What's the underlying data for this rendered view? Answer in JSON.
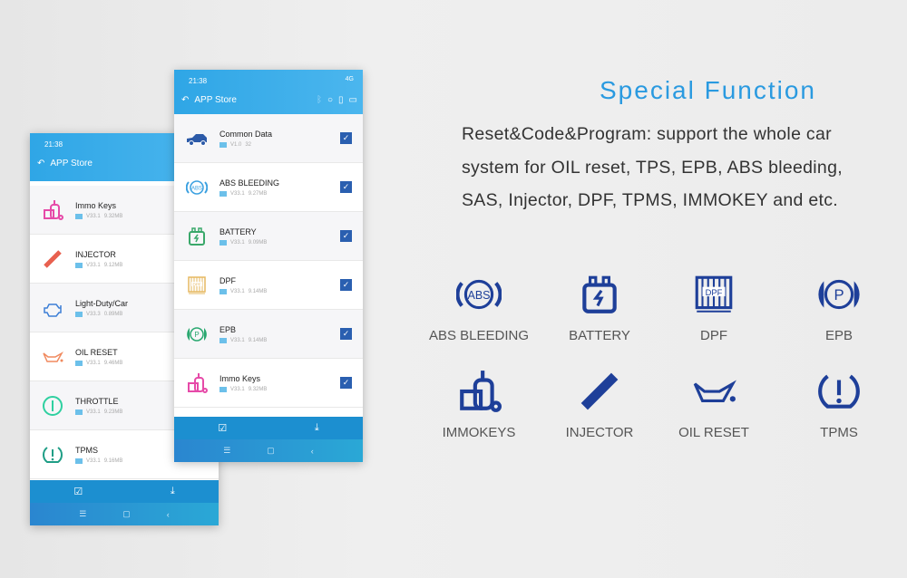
{
  "back_phone": {
    "time": "21:38",
    "title": "APP Store",
    "items": [
      {
        "name": "Immo Keys",
        "version": "V33.1",
        "size": "9.32MB",
        "icon": "immo-keys-icon",
        "color": "#e64aa8"
      },
      {
        "name": "INJECTOR",
        "version": "V33.1",
        "size": "9.12MB",
        "icon": "injector-icon",
        "color": "#e8604f"
      },
      {
        "name": "Light-Duty/Car",
        "version": "V33.3",
        "size": "0.89MB",
        "icon": "engine-icon",
        "color": "#3d7fd6"
      },
      {
        "name": "OIL RESET",
        "version": "V33.1",
        "size": "9.46MB",
        "icon": "oil-can-icon",
        "color": "#f08a5f"
      },
      {
        "name": "THROTTLE",
        "version": "V33.1",
        "size": "9.23MB",
        "icon": "throttle-icon",
        "color": "#2fd0a0"
      },
      {
        "name": "TPMS",
        "version": "V33.1",
        "size": "9.16MB",
        "icon": "tpms-icon",
        "color": "#1f9e86"
      }
    ]
  },
  "front_phone": {
    "time": "21:38",
    "status": "4G",
    "title": "APP Store",
    "items": [
      {
        "name": "Common Data",
        "version": "V1.0",
        "size": "32",
        "icon": "car-icon",
        "color": "#2c5aa8",
        "checked": true
      },
      {
        "name": "ABS BLEEDING",
        "version": "V33.1",
        "size": "9.27MB",
        "icon": "abs-icon",
        "color": "#3aa0e0",
        "checked": true
      },
      {
        "name": "BATTERY",
        "version": "V33.1",
        "size": "9.09MB",
        "icon": "battery-icon",
        "color": "#3aa86a",
        "checked": true
      },
      {
        "name": "DPF",
        "version": "V33.1",
        "size": "9.14MB",
        "icon": "dpf-icon",
        "color": "#e6b860",
        "checked": true
      },
      {
        "name": "EPB",
        "version": "V33.1",
        "size": "9.14MB",
        "icon": "epb-icon",
        "color": "#2aa870",
        "checked": true
      },
      {
        "name": "Immo Keys",
        "version": "V33.1",
        "size": "9.32MB",
        "icon": "immo-keys-icon",
        "color": "#e64aa8",
        "checked": true
      }
    ]
  },
  "heading": "Special Function",
  "description": [
    "Reset&Code&Program: support the whole car",
    "system for OIL reset, TPS, EPB, ABS bleeding,",
    "SAS, Injector, DPF, TPMS, IMMOKEY and etc."
  ],
  "functions": [
    "ABS BLEEDING",
    "BATTERY",
    "DPF",
    "EPB",
    "IMMOKEYS",
    "INJECTOR",
    "OIL RESET",
    "TPMS"
  ],
  "colors": {
    "accent": "#2a9ae0",
    "icon": "#1e3f99",
    "header": "#3aaeea"
  }
}
